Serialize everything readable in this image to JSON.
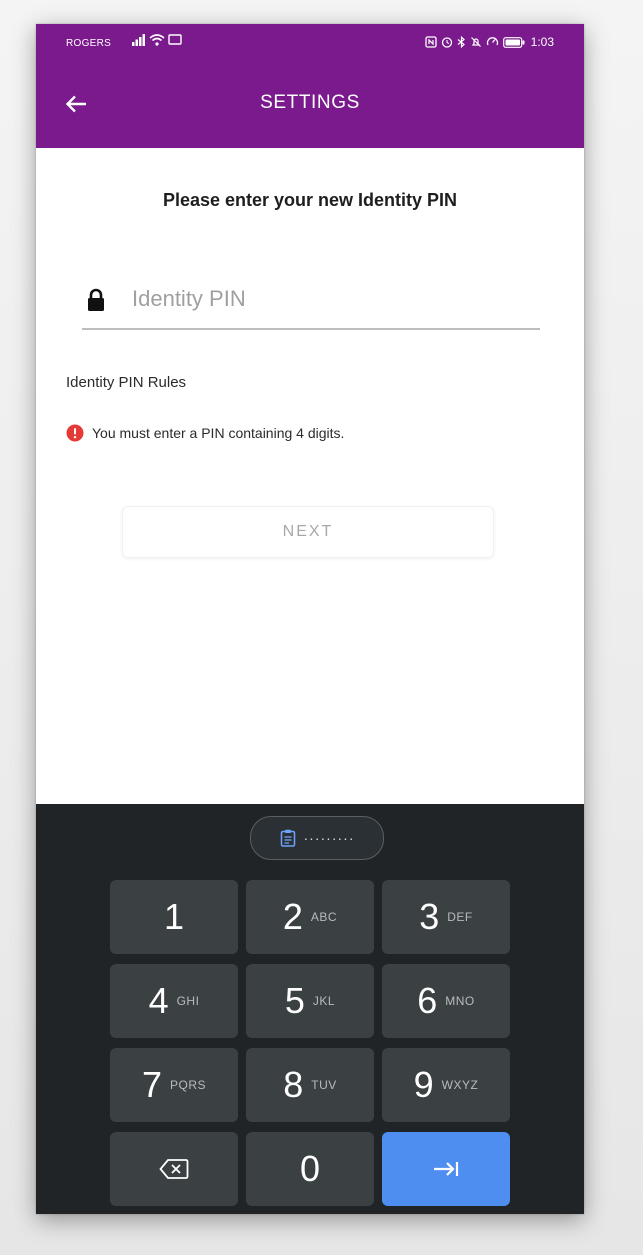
{
  "status_bar": {
    "carrier": "ROGERS",
    "time": "1:03"
  },
  "app_bar": {
    "title": "SETTINGS",
    "back_icon": "arrow-left-icon",
    "color": "#7a1a8c"
  },
  "form": {
    "heading": "Please enter your new Identity PIN",
    "pin_placeholder": "Identity PIN",
    "pin_value": "",
    "rules_title": "Identity PIN Rules",
    "rule_error": "You must enter a PIN containing 4 digits.",
    "next_label": "NEXT"
  },
  "keyboard": {
    "clipboard_preview": "·········",
    "keys": [
      {
        "num": "1",
        "letters": ""
      },
      {
        "num": "2",
        "letters": "ABC"
      },
      {
        "num": "3",
        "letters": "DEF"
      },
      {
        "num": "4",
        "letters": "GHI"
      },
      {
        "num": "5",
        "letters": "JKL"
      },
      {
        "num": "6",
        "letters": "MNO"
      },
      {
        "num": "7",
        "letters": "PQRS"
      },
      {
        "num": "8",
        "letters": "TUV"
      },
      {
        "num": "9",
        "letters": "WXYZ"
      },
      {
        "num": "0",
        "letters": ""
      }
    ],
    "accent": "#4d8ef0"
  }
}
